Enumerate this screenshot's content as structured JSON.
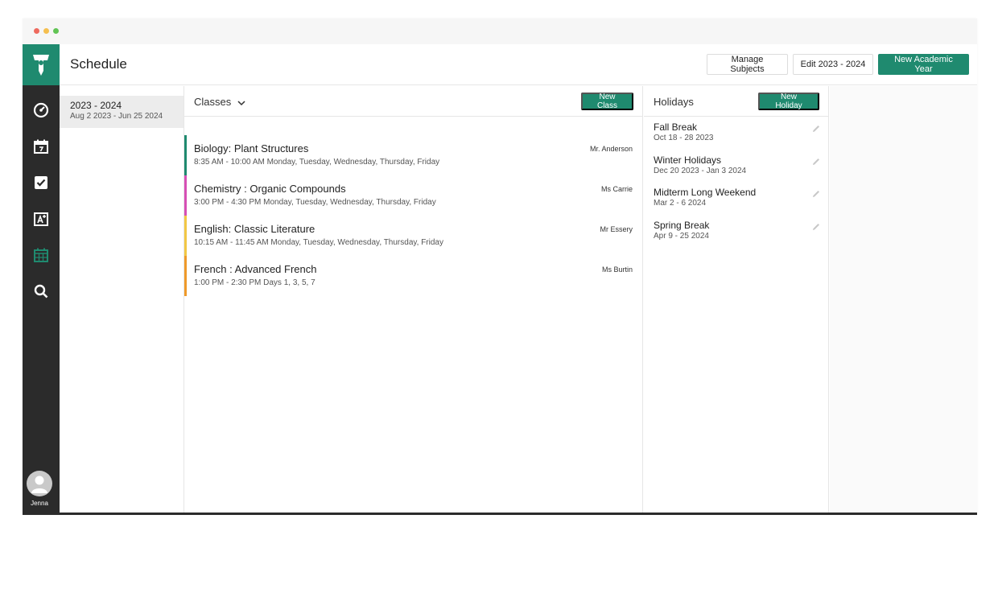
{
  "window": {
    "title": "Schedule"
  },
  "sidebar": {
    "user_name": "Jenna",
    "nav": [
      {
        "icon": "dashboard-gauge-icon"
      },
      {
        "icon": "calendar-day-icon"
      },
      {
        "icon": "checkbox-icon"
      },
      {
        "icon": "grades-icon"
      },
      {
        "icon": "schedule-calendar-icon",
        "active": true
      },
      {
        "icon": "search-icon"
      }
    ]
  },
  "toolbar": {
    "manage_subjects": "Manage Subjects",
    "edit_year": "Edit 2023 - 2024",
    "new_academic_year": "New Academic Year"
  },
  "years": [
    {
      "title": "2023 - 2024",
      "range": "Aug 2 2023 - Jun 25 2024",
      "selected": true
    }
  ],
  "classes": {
    "header": "Classes",
    "new_button": "New Class",
    "items": [
      {
        "name": "Biology: Plant Structures",
        "time": "8:35 AM - 10:00 AM Monday, Tuesday, Wednesday, Thursday, Friday",
        "teacher": "Mr. Anderson",
        "color": "#1f8a6f"
      },
      {
        "name": "Chemistry : Organic Compounds",
        "time": "3:00 PM - 4:30 PM Monday, Tuesday, Wednesday, Thursday, Friday",
        "teacher": "Ms Carrie",
        "color": "#d64fb5"
      },
      {
        "name": "English: Classic Literature",
        "time": "10:15 AM - 11:45 AM Monday, Tuesday, Wednesday, Thursday, Friday",
        "teacher": "Mr Essery",
        "color": "#f2c744"
      },
      {
        "name": "French : Advanced French",
        "time": "1:00 PM - 2:30 PM Days 1, 3, 5, 7",
        "teacher": "Ms Burtin",
        "color": "#ef9a2a"
      }
    ]
  },
  "holidays": {
    "header": "Holidays",
    "new_button": "New Holiday",
    "items": [
      {
        "name": "Fall Break",
        "date": "Oct 18 - 28 2023"
      },
      {
        "name": "Winter Holidays",
        "date": "Dec 20 2023 - Jan 3 2024"
      },
      {
        "name": "Midterm Long Weekend",
        "date": "Mar 2 - 6 2024"
      },
      {
        "name": "Spring Break",
        "date": "Apr 9 - 25 2024"
      }
    ]
  },
  "colors": {
    "accent": "#1f8a6f",
    "sidebar": "#2b2b2b"
  }
}
